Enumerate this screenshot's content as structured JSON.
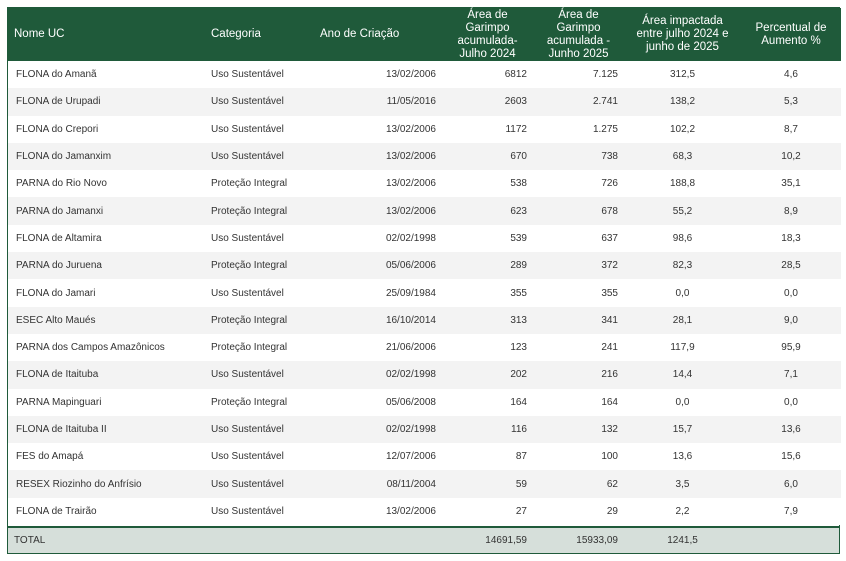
{
  "headers": {
    "nome": "Nome UC",
    "categoria": "Categoria",
    "ano": "Ano de Criação",
    "area2024": "Área de Garimpo acumulada-Julho 2024",
    "area2025": "Área de Garimpo acumulada - Junho 2025",
    "impactada": "Área impactada entre julho 2024 e junho de 2025",
    "percentual": "Percentual de Aumento %"
  },
  "rows": [
    {
      "nome": "FLONA do Amanã",
      "categoria": "Uso Sustentável",
      "ano": "13/02/2006",
      "a2024": "6812",
      "a2025": "7.125",
      "imp": "312,5",
      "pct": "4,6"
    },
    {
      "nome": "FLONA de Urupadi",
      "categoria": "Uso Sustentável",
      "ano": "11/05/2016",
      "a2024": "2603",
      "a2025": "2.741",
      "imp": "138,2",
      "pct": "5,3"
    },
    {
      "nome": "FLONA do Crepori",
      "categoria": "Uso Sustentável",
      "ano": "13/02/2006",
      "a2024": "1172",
      "a2025": "1.275",
      "imp": "102,2",
      "pct": "8,7"
    },
    {
      "nome": "FLONA do Jamanxim",
      "categoria": "Uso Sustentável",
      "ano": "13/02/2006",
      "a2024": "670",
      "a2025": "738",
      "imp": "68,3",
      "pct": "10,2"
    },
    {
      "nome": "PARNA do Rio Novo",
      "categoria": "Proteção Integral",
      "ano": "13/02/2006",
      "a2024": "538",
      "a2025": "726",
      "imp": "188,8",
      "pct": "35,1"
    },
    {
      "nome": "PARNA do Jamanxi",
      "categoria": "Proteção Integral",
      "ano": "13/02/2006",
      "a2024": "623",
      "a2025": "678",
      "imp": "55,2",
      "pct": "8,9"
    },
    {
      "nome": "FLONA de Altamira",
      "categoria": "Uso Sustentável",
      "ano": "02/02/1998",
      "a2024": "539",
      "a2025": "637",
      "imp": "98,6",
      "pct": "18,3"
    },
    {
      "nome": "PARNA do Juruena",
      "categoria": "Proteção Integral",
      "ano": "05/06/2006",
      "a2024": "289",
      "a2025": "372",
      "imp": "82,3",
      "pct": "28,5"
    },
    {
      "nome": "FLONA do Jamari",
      "categoria": "Uso Sustentável",
      "ano": "25/09/1984",
      "a2024": "355",
      "a2025": "355",
      "imp": "0,0",
      "pct": "0,0"
    },
    {
      "nome": "ESEC Alto Maués",
      "categoria": "Proteção Integral",
      "ano": "16/10/2014",
      "a2024": "313",
      "a2025": "341",
      "imp": "28,1",
      "pct": "9,0"
    },
    {
      "nome": "PARNA dos Campos Amazônicos",
      "categoria": "Proteção Integral",
      "ano": "21/06/2006",
      "a2024": "123",
      "a2025": "241",
      "imp": "117,9",
      "pct": "95,9"
    },
    {
      "nome": "FLONA de Itaituba",
      "categoria": "Uso Sustentável",
      "ano": "02/02/1998",
      "a2024": "202",
      "a2025": "216",
      "imp": "14,4",
      "pct": "7,1"
    },
    {
      "nome": "PARNA Mapinguari",
      "categoria": "Proteção Integral",
      "ano": "05/06/2008",
      "a2024": "164",
      "a2025": "164",
      "imp": "0,0",
      "pct": "0,0"
    },
    {
      "nome": "FLONA de Itaituba II",
      "categoria": "Uso Sustentável",
      "ano": "02/02/1998",
      "a2024": "116",
      "a2025": "132",
      "imp": "15,7",
      "pct": "13,6"
    },
    {
      "nome": "FES do Amapá",
      "categoria": "Uso Sustentável",
      "ano": "12/07/2006",
      "a2024": "87",
      "a2025": "100",
      "imp": "13,6",
      "pct": "15,6"
    },
    {
      "nome": "RESEX Riozinho do Anfrísio",
      "categoria": "Uso Sustentável",
      "ano": "08/11/2004",
      "a2024": "59",
      "a2025": "62",
      "imp": "3,5",
      "pct": "6,0"
    },
    {
      "nome": "FLONA de Trairão",
      "categoria": "Uso Sustentável",
      "ano": "13/02/2006",
      "a2024": "27",
      "a2025": "29",
      "imp": "2,2",
      "pct": "7,9"
    }
  ],
  "total": {
    "label": "TOTAL",
    "a2024": "14691,59",
    "a2025": "15933,09",
    "imp": "1241,5"
  },
  "colors": {
    "header_bg": "#1f5a3a",
    "row_alt": "#f3f3f3",
    "total_bg": "#d6dfda"
  }
}
